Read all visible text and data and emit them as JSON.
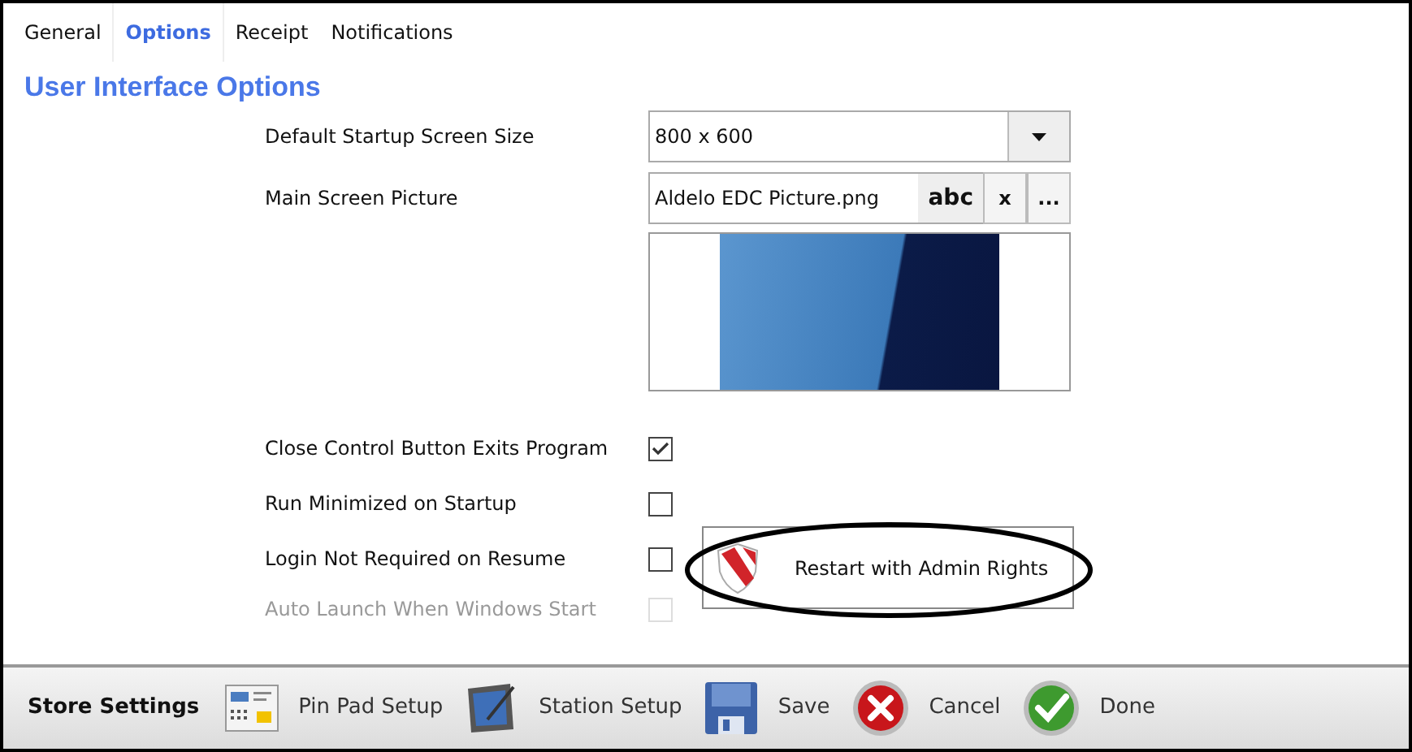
{
  "tabs": [
    {
      "label": "General",
      "selected": false
    },
    {
      "label": "Options",
      "selected": true
    },
    {
      "label": "Receipt",
      "selected": false
    },
    {
      "label": "Notifications",
      "selected": false
    }
  ],
  "heading": "User Interface Options",
  "startup_size": {
    "label": "Default Startup Screen Size",
    "value": "800 x 600"
  },
  "main_picture": {
    "label": "Main Screen Picture",
    "value": "Aldelo EDC Picture.png",
    "buttons": [
      "abc",
      "x",
      "..."
    ]
  },
  "options": [
    {
      "label": "Close Control Button Exits Program",
      "checked": true,
      "disabled": false
    },
    {
      "label": "Run Minimized on Startup",
      "checked": false,
      "disabled": false
    },
    {
      "label": "Login Not Required on Resume",
      "checked": false,
      "disabled": false
    },
    {
      "label": "Auto Launch When Windows Start",
      "checked": false,
      "disabled": true
    }
  ],
  "restart_button": "Restart with Admin Rights",
  "footer": {
    "title": "Store Settings",
    "buttons": [
      {
        "kind": "pinpad",
        "label": "Pin Pad Setup"
      },
      {
        "kind": "station",
        "label": "Station Setup"
      },
      {
        "kind": "save",
        "label": "Save"
      },
      {
        "kind": "cancel",
        "label": "Cancel"
      },
      {
        "kind": "done",
        "label": "Done"
      }
    ]
  }
}
